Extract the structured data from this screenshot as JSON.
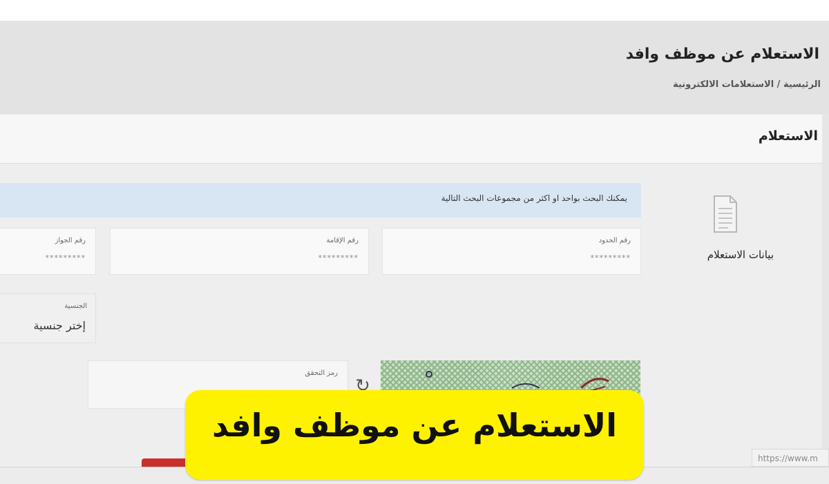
{
  "header": {
    "title": "الاستعلام عن موظف وافد",
    "breadcrumb": "الرئيسية / الاستعلامات الالكترونية"
  },
  "panel": {
    "title": "الاستعلام",
    "side_tab": {
      "icon": "document-icon",
      "label": "بيانات الاستعلام"
    },
    "info_text": "يمكنك البحث بواحد او اكثر من مجموعات البحث التالية",
    "fields": {
      "border_number": {
        "label": "رقم الحدود",
        "placeholder": "*********"
      },
      "iqama_number": {
        "label": "رقم الإقامة",
        "placeholder": "*********"
      },
      "passport_number": {
        "label": "رقم الجواز",
        "placeholder": "*********"
      }
    },
    "nationality": {
      "label": "الجنسية",
      "value": "إختر جنسية"
    },
    "captcha": {
      "label": "رمز التحقق",
      "refresh_icon": "refresh-icon"
    }
  },
  "browser": {
    "url": "https://www.m"
  },
  "caption": {
    "text": "الاستعلام عن موظف وافد"
  },
  "colors": {
    "caption_bg": "#fff200",
    "info_bg": "#d8e6f4",
    "submit_button": "#c9302c"
  }
}
